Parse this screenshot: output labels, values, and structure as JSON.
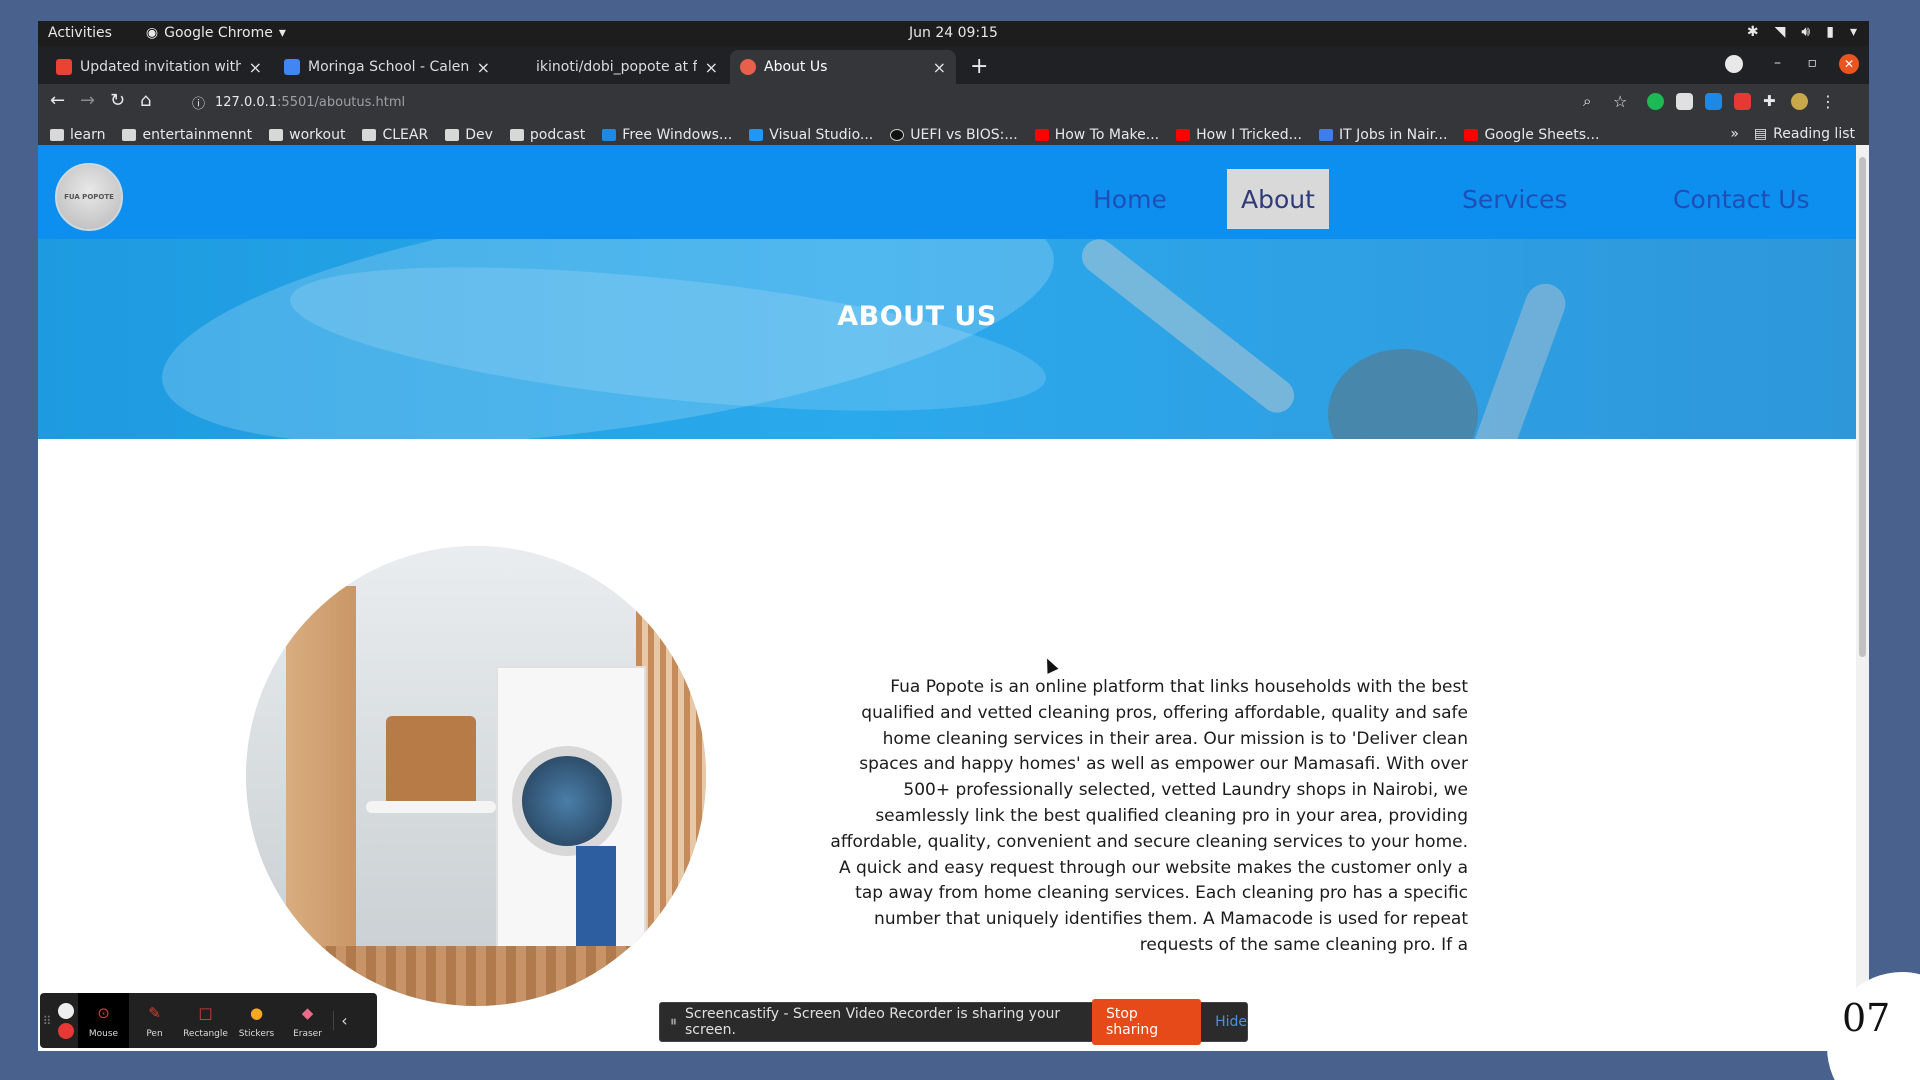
{
  "system_bar": {
    "activities": "Activities",
    "app_name": "Google Chrome",
    "clock": "Jun 24  09:15"
  },
  "tabs": [
    {
      "title": "Updated invitation with",
      "favicon_color": "#ea4335"
    },
    {
      "title": "Moringa School - Calendar",
      "favicon_color": "#4285f4"
    },
    {
      "title": "ikinoti/dobi_popote at ft",
      "favicon_color": "#202124"
    },
    {
      "title": "About Us",
      "favicon_color": "#e8604c"
    }
  ],
  "toolbar": {
    "url_host": "127.0.0.1",
    "url_rest": ":5501/aboutus.html"
  },
  "bookmarks": [
    {
      "label": "learn",
      "type": "folder"
    },
    {
      "label": "entertainmennt",
      "type": "folder"
    },
    {
      "label": "workout",
      "type": "folder"
    },
    {
      "label": "CLEAR",
      "type": "folder"
    },
    {
      "label": "Dev",
      "type": "folder"
    },
    {
      "label": "podcast",
      "type": "folder"
    },
    {
      "label": "Free Windows...",
      "type": "link",
      "color": "#1e88e5"
    },
    {
      "label": "Visual Studio...",
      "type": "link",
      "color": "#2196f3"
    },
    {
      "label": "UEFI vs BIOS:...",
      "type": "link",
      "color": "#111111"
    },
    {
      "label": "How To Make...",
      "type": "link",
      "color": "#ff0000"
    },
    {
      "label": "How I Tricked...",
      "type": "link",
      "color": "#ff0000"
    },
    {
      "label": "IT Jobs in Nair...",
      "type": "link",
      "color": "#3f7de8"
    },
    {
      "label": "Google Sheets...",
      "type": "link",
      "color": "#ff0000"
    }
  ],
  "bookmarks_overflow": "»",
  "reading_list": "Reading list",
  "site": {
    "logo_text": "FUA POPOTE",
    "nav": [
      {
        "label": "Home",
        "active": false
      },
      {
        "label": "About",
        "active": true
      },
      {
        "label": "Services",
        "active": false
      },
      {
        "label": "Contact Us",
        "active": false
      }
    ],
    "hero_title": "ABOUT US",
    "about_lines": [
      "Fua Popote is an online platform that links households with the best",
      "qualified and vetted cleaning pros, offering affordable, quality and safe",
      "home cleaning services in their area. Our mission is to 'Deliver clean",
      "spaces and happy homes' as well as empower our Mamasafi. With over",
      "500+ professionally selected, vetted Laundry shops in Nairobi, we",
      "seamlessly link the best qualified cleaning pro in your area, providing",
      "affordable, quality, convenient and secure cleaning services to your home.",
      "A quick and easy request through our website makes the customer only a",
      "tap away from home cleaning services. Each cleaning pro has a specific",
      "number that uniquely identifies them. A Mamacode is used for repeat",
      "requests of the same cleaning pro. If a"
    ]
  },
  "screencastify": {
    "tools": [
      {
        "label": "Mouse",
        "icon": "mouse-cursor-icon",
        "active": true
      },
      {
        "label": "Pen",
        "icon": "pen-icon",
        "active": false
      },
      {
        "label": "Rectangle",
        "icon": "rectangle-icon",
        "active": false
      },
      {
        "label": "Stickers",
        "icon": "sticker-icon",
        "active": false
      },
      {
        "label": "Eraser",
        "icon": "eraser-icon",
        "active": false
      }
    ],
    "share_message": "Screencastify - Screen Video Recorder is sharing your screen.",
    "stop_label": "Stop sharing",
    "hide_label": "Hide"
  },
  "corner_number": "07",
  "colors": {
    "site_nav_bg": "#0d8ff0",
    "nav_link": "#1f4fb6",
    "stop_button": "#e64a19",
    "desktop_bg": "#48618d"
  }
}
